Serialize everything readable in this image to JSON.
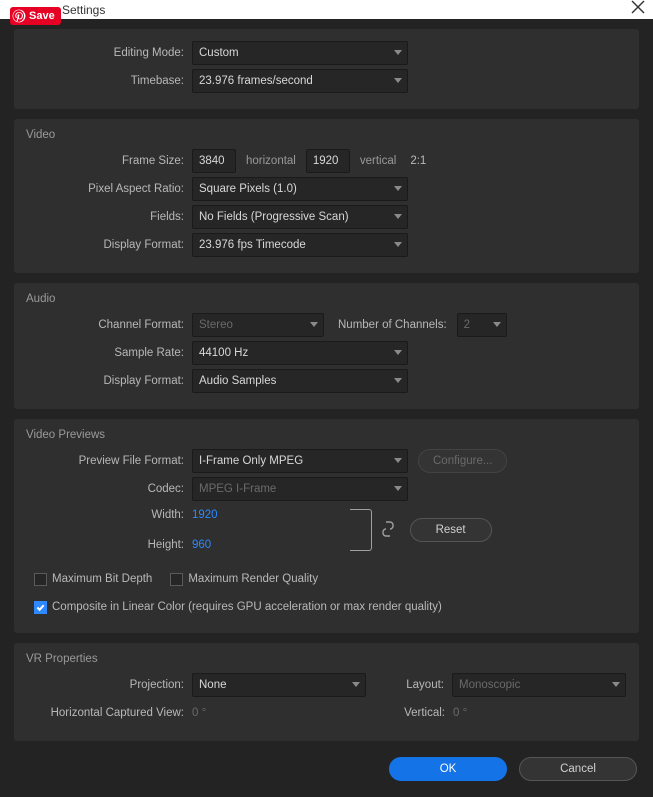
{
  "titlebar": {
    "title": "Settings",
    "save": "Save"
  },
  "general": {
    "editing_mode_label": "Editing Mode:",
    "editing_mode": "Custom",
    "timebase_label": "Timebase:",
    "timebase": "23.976  frames/second"
  },
  "video": {
    "heading": "Video",
    "frame_size_label": "Frame Size:",
    "width": "3840",
    "horizontal": "horizontal",
    "height": "1920",
    "vertical": "vertical",
    "ratio": "2:1",
    "par_label": "Pixel Aspect Ratio:",
    "par": "Square Pixels (1.0)",
    "fields_label": "Fields:",
    "fields": "No Fields (Progressive Scan)",
    "display_format_label": "Display Format:",
    "display_format": "23.976 fps Timecode"
  },
  "audio": {
    "heading": "Audio",
    "channel_format_label": "Channel Format:",
    "channel_format": "Stereo",
    "num_channels_label": "Number of Channels:",
    "num_channels": "2",
    "sample_rate_label": "Sample Rate:",
    "sample_rate": "44100 Hz",
    "display_format_label": "Display Format:",
    "display_format": "Audio Samples"
  },
  "previews": {
    "heading": "Video Previews",
    "pff_label": "Preview File Format:",
    "pff": "I-Frame Only MPEG",
    "configure": "Configure...",
    "codec_label": "Codec:",
    "codec": "MPEG I-Frame",
    "width_label": "Width:",
    "width": "1920",
    "height_label": "Height:",
    "height": "960",
    "reset": "Reset",
    "max_bit_depth": "Maximum Bit Depth",
    "max_render_quality": "Maximum Render Quality",
    "composite": "Composite in Linear Color (requires GPU acceleration or max render quality)"
  },
  "vr": {
    "heading": "VR Properties",
    "projection_label": "Projection:",
    "projection": "None",
    "layout_label": "Layout:",
    "layout": "Monoscopic",
    "hcv_label": "Horizontal Captured View:",
    "hcv": "0 °",
    "vertical_label": "Vertical:",
    "vertical": "0 °"
  },
  "footer": {
    "ok": "OK",
    "cancel": "Cancel"
  }
}
